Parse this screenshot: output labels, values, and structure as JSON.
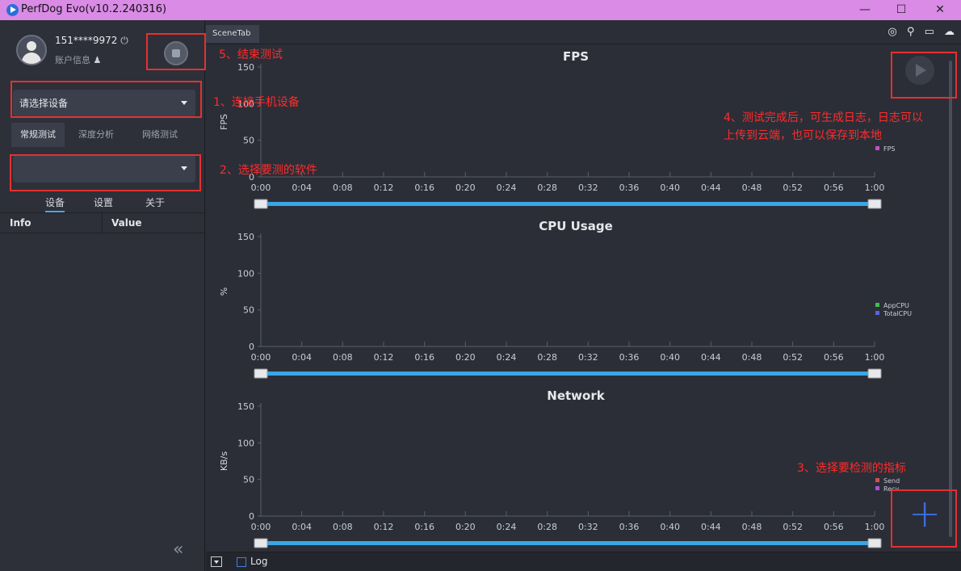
{
  "window": {
    "title": "PerfDog Evo(v10.2.240316)",
    "minimize": "—",
    "maximize": "☐",
    "close": "✕"
  },
  "user": {
    "name": "151****9972",
    "power_icon": "power-icon",
    "account_label": "账户信息"
  },
  "device_select": {
    "value": "请选择设备"
  },
  "app_select": {
    "value": ""
  },
  "tabs": [
    "常规测试",
    "深度分析",
    "网络测试"
  ],
  "subtabs": [
    "设备",
    "设置",
    "关于"
  ],
  "info_table": {
    "col_info": "Info",
    "col_value": "Value"
  },
  "scene_tab": "SceneTab",
  "bottom": {
    "log_label": "Log"
  },
  "annotations": {
    "a1": "1、连接手机设备",
    "a2": "2、选择要测的软件",
    "a3": "3、选择要检测的指标",
    "a4_line1": "4、测试完成后，可生成日志，日志可以",
    "a4_line2": "上传到云端，也可以保存到本地",
    "a5": "5、结束测试"
  },
  "chart_data": [
    {
      "type": "line",
      "title": "FPS",
      "ylabel": "FPS",
      "ylim": [
        0,
        150
      ],
      "yticks": [
        0,
        50,
        100,
        150
      ],
      "xticks": [
        "0:00",
        "0:04",
        "0:08",
        "0:12",
        "0:16",
        "0:20",
        "0:24",
        "0:28",
        "0:32",
        "0:36",
        "0:40",
        "0:44",
        "0:48",
        "0:52",
        "0:56",
        "1:00"
      ],
      "series": [
        {
          "name": "FPS",
          "color": "#c24fc6",
          "values": []
        }
      ]
    },
    {
      "type": "line",
      "title": "CPU Usage",
      "ylabel": "%",
      "ylim": [
        0,
        150
      ],
      "yticks": [
        0,
        50,
        100,
        150
      ],
      "xticks": [
        "0:00",
        "0:04",
        "0:08",
        "0:12",
        "0:16",
        "0:20",
        "0:24",
        "0:28",
        "0:32",
        "0:36",
        "0:40",
        "0:44",
        "0:48",
        "0:52",
        "0:56",
        "1:00"
      ],
      "series": [
        {
          "name": "AppCPU",
          "color": "#3fbf4f",
          "values": []
        },
        {
          "name": "TotalCPU",
          "color": "#5566e0",
          "values": []
        }
      ]
    },
    {
      "type": "line",
      "title": "Network",
      "ylabel": "KB/s",
      "ylim": [
        0,
        150
      ],
      "yticks": [
        0,
        50,
        100,
        150
      ],
      "xticks": [
        "0:00",
        "0:04",
        "0:08",
        "0:12",
        "0:16",
        "0:20",
        "0:24",
        "0:28",
        "0:32",
        "0:36",
        "0:40",
        "0:44",
        "0:48",
        "0:52",
        "0:56",
        "1:00"
      ],
      "series": [
        {
          "name": "Send",
          "color": "#d05050",
          "values": []
        },
        {
          "name": "Recv",
          "color": "#b04fd0",
          "values": []
        }
      ]
    }
  ]
}
